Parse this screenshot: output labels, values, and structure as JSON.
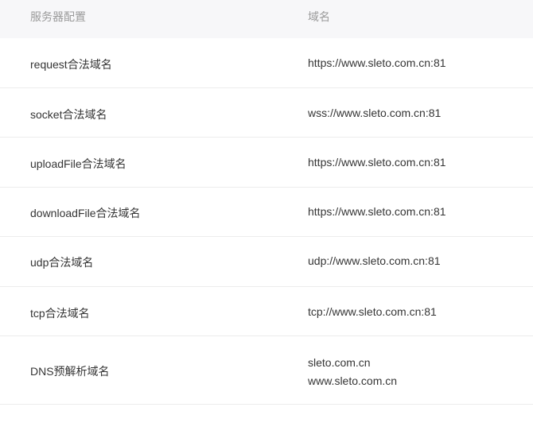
{
  "table": {
    "headers": [
      "服务器配置",
      "域名"
    ],
    "rows": [
      {
        "key": "request合法域名",
        "values": [
          "https://www.sleto.com.cn:81"
        ]
      },
      {
        "key": "socket合法域名",
        "values": [
          "wss://www.sleto.com.cn:81"
        ]
      },
      {
        "key": "uploadFile合法域名",
        "values": [
          "https://www.sleto.com.cn:81"
        ]
      },
      {
        "key": "downloadFile合法域名",
        "values": [
          "https://www.sleto.com.cn:81"
        ]
      },
      {
        "key": "udp合法域名",
        "values": [
          "udp://www.sleto.com.cn:81"
        ]
      },
      {
        "key": "tcp合法域名",
        "values": [
          "tcp://www.sleto.com.cn:81"
        ]
      },
      {
        "key": "DNS预解析域名",
        "values": [
          "sleto.com.cn",
          "www.sleto.com.cn"
        ]
      }
    ]
  }
}
